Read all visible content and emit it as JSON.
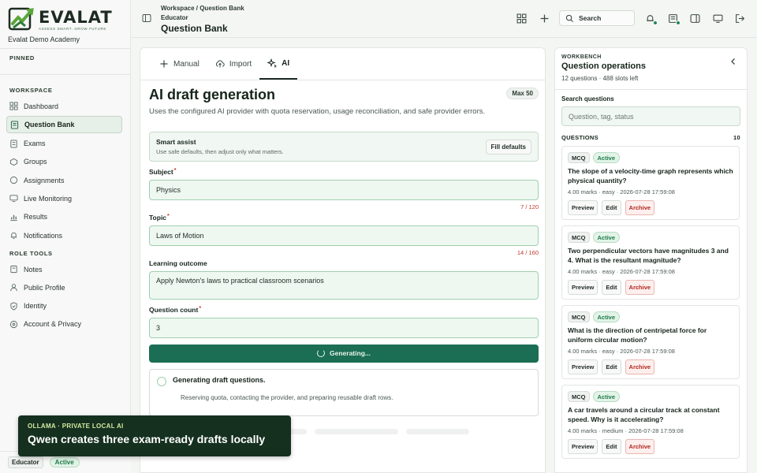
{
  "brand": {
    "name": "EVALAT",
    "tagline": "ASSESS SMART. GROW FUTURE",
    "academy": "Evalat Demo Academy"
  },
  "sidebar": {
    "pinned_label": "PINNED",
    "workspace_label": "WORKSPACE",
    "workspace_items": [
      {
        "label": "Dashboard",
        "icon": "dashboard-icon"
      },
      {
        "label": "Question Bank",
        "icon": "question-bank-icon",
        "active": true
      },
      {
        "label": "Exams",
        "icon": "exams-icon"
      },
      {
        "label": "Groups",
        "icon": "groups-icon"
      },
      {
        "label": "Assignments",
        "icon": "assignments-icon"
      },
      {
        "label": "Live Monitoring",
        "icon": "monitor-icon"
      },
      {
        "label": "Results",
        "icon": "results-icon"
      },
      {
        "label": "Notifications",
        "icon": "bell-icon"
      }
    ],
    "role_tools_label": "ROLE TOOLS",
    "role_items": [
      {
        "label": "Notes",
        "icon": "notes-icon"
      },
      {
        "label": "Public Profile",
        "icon": "profile-icon"
      },
      {
        "label": "Identity",
        "icon": "shield-icon"
      },
      {
        "label": "Account & Privacy",
        "icon": "account-icon"
      }
    ],
    "footer": {
      "role": "Educator",
      "status": "Active"
    }
  },
  "topbar": {
    "breadcrumb": "Workspace / Question Bank",
    "role": "Educator",
    "title": "Question Bank",
    "search_label": "Search"
  },
  "main": {
    "tabs": [
      {
        "label": "Manual",
        "icon": "plus-icon"
      },
      {
        "label": "Import",
        "icon": "upload-cloud-icon"
      },
      {
        "label": "AI",
        "icon": "sparkle-icon",
        "active": true
      }
    ],
    "heading": "AI draft generation",
    "max_badge": "Max 50",
    "description": "Uses the configured AI provider with quota reservation, usage reconciliation, and safe provider errors.",
    "assist": {
      "title": "Smart assist",
      "subtitle": "Use safe defaults, then adjust only what matters.",
      "button": "Fill defaults"
    },
    "fields": {
      "subject": {
        "label": "Subject",
        "value": "Physics",
        "counter": "7 / 120"
      },
      "topic": {
        "label": "Topic",
        "value": "Laws of Motion",
        "counter": "14 / 160"
      },
      "outcome": {
        "label": "Learning outcome",
        "value": "Apply Newton's laws to practical classroom scenarios"
      },
      "count": {
        "label": "Question count",
        "value": "3"
      }
    },
    "generate_button": "Generating...",
    "status": {
      "title": "Generating draft questions.",
      "subtitle": "Reserving quota, contacting the provider, and preparing reusable draft rows."
    }
  },
  "toast": {
    "kicker": "OLLAMA · PRIVATE LOCAL AI",
    "message": "Qwen creates three exam-ready drafts locally"
  },
  "workbench": {
    "kicker": "WORKBENCH",
    "title": "Question operations",
    "subtitle": "12 questions · 488 slots left",
    "search_label": "Search questions",
    "search_placeholder": "Question, tag, status",
    "questions_label": "QUESTIONS",
    "questions_count": "10",
    "actions": {
      "preview": "Preview",
      "edit": "Edit",
      "archive": "Archive"
    },
    "questions": [
      {
        "type": "MCQ",
        "status": "Active",
        "text": "The slope of a velocity-time graph represents which physical quantity?",
        "meta": "4.00 marks · easy · 2026-07-28 17:59:08"
      },
      {
        "type": "MCQ",
        "status": "Active",
        "text": "Two perpendicular vectors have magnitudes 3 and 4. What is the resultant magnitude?",
        "meta": "4.00 marks · easy · 2026-07-28 17:59:08"
      },
      {
        "type": "MCQ",
        "status": "Active",
        "text": "What is the direction of centripetal force for uniform circular motion?",
        "meta": "4.00 marks · easy · 2026-07-28 17:59:08"
      },
      {
        "type": "MCQ",
        "status": "Active",
        "text": "A car travels around a circular track at constant speed. Why is it accelerating?",
        "meta": "4.00 marks · medium · 2026-07-28 17:59:08"
      }
    ]
  },
  "colors": {
    "accent": "#1b6e54",
    "active_green": "#1d7a46",
    "archive_red": "#b3261e",
    "toast_bg": "#15301f"
  }
}
